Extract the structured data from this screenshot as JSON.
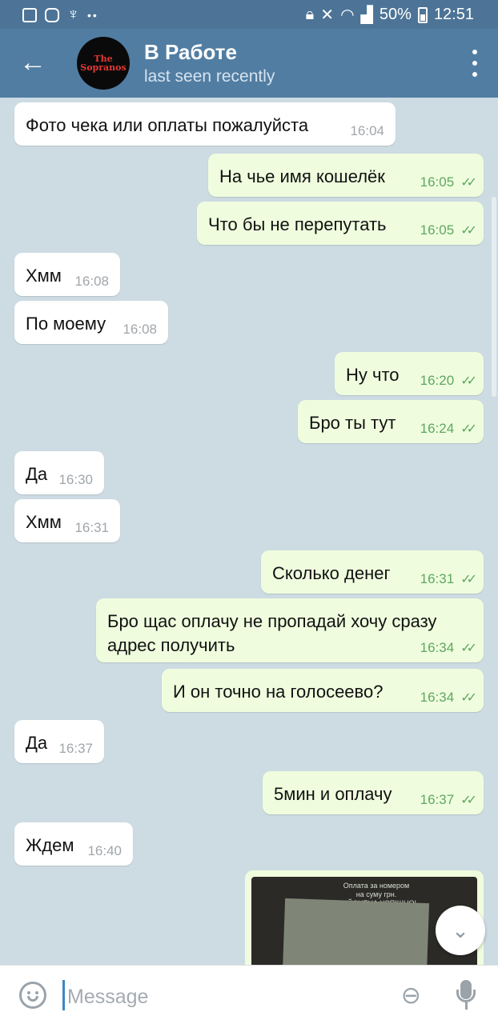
{
  "status_bar": {
    "battery": "50%",
    "time": "12:51",
    "left_icons": [
      "gallery-icon",
      "instagram-icon",
      "accessibility-icon",
      "more-dots-icon"
    ],
    "right_icons": [
      "lock-icon",
      "mute-icon",
      "wifi-icon",
      "signal-icon",
      "battery-icon"
    ]
  },
  "header": {
    "title": "В Работе",
    "subtitle": "last seen recently",
    "avatar_text": "The Sopranos"
  },
  "messages": [
    {
      "dir": "in",
      "text": "Фото чека или оплаты пожалуйста",
      "time": "16:04"
    },
    {
      "dir": "out",
      "text": "На чье имя кошелёк",
      "time": "16:05",
      "read": true
    },
    {
      "dir": "out",
      "text": "Что бы не перепутать",
      "time": "16:05",
      "read": true
    },
    {
      "dir": "in",
      "text": "Хмм",
      "time": "16:08"
    },
    {
      "dir": "in",
      "text": "По моему",
      "time": "16:08"
    },
    {
      "dir": "out",
      "text": "Ну что",
      "time": "16:20",
      "read": true
    },
    {
      "dir": "out",
      "text": "Бро ты тут",
      "time": "16:24",
      "read": true
    },
    {
      "dir": "in",
      "text": "Да",
      "time": "16:30"
    },
    {
      "dir": "in",
      "text": "Хмм",
      "time": "16:31"
    },
    {
      "dir": "out",
      "text": "Сколько денег",
      "time": "16:31",
      "read": true
    },
    {
      "dir": "out",
      "text": "Бро щас оплачу не пропадай хочу сразу\nадрес получить",
      "time": "16:34",
      "read": true
    },
    {
      "dir": "out",
      "text": "И он точно на голосеево?",
      "time": "16:34",
      "read": true
    },
    {
      "dir": "in",
      "text": "Да",
      "time": "16:37"
    },
    {
      "dir": "out",
      "text": "5мин и оплачу",
      "time": "16:37",
      "read": true
    },
    {
      "dir": "in",
      "text": "Ждем",
      "time": "16:40"
    }
  ],
  "photo_message": {
    "caption_lines": [
      "Оплата за номером",
      "на суму грн.",
      "ЗДІЙСНЕНА УСПІШНО!"
    ]
  },
  "composer": {
    "placeholder": "Message"
  },
  "colors": {
    "header_bg": "#517da2",
    "statusbar_bg": "#4d7497",
    "incoming_bubble": "#ffffff",
    "outgoing_bubble": "#effdde",
    "read_check": "#5fa761",
    "chat_bg": "#cddbe3"
  }
}
